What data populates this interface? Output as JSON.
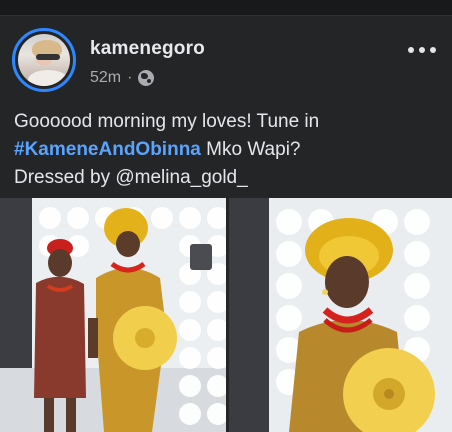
{
  "post": {
    "username": "kamenegoro",
    "time": "52m",
    "separator": "·",
    "caption_line1": "Goooood morning my loves! Tune in",
    "hashtag": "#KameneAndObinna",
    "caption_line2_rest": " Mko Wapi?",
    "caption_line3": "Dressed by @melina_gold_"
  },
  "icons": {
    "privacy": "globe-icon",
    "menu": "more-options-icon"
  },
  "colors": {
    "background": "#242527",
    "text": "#e4e6eb",
    "muted": "#a8abb0",
    "hashtag": "#5aa4ff",
    "story_ring": "#2d88ff"
  }
}
